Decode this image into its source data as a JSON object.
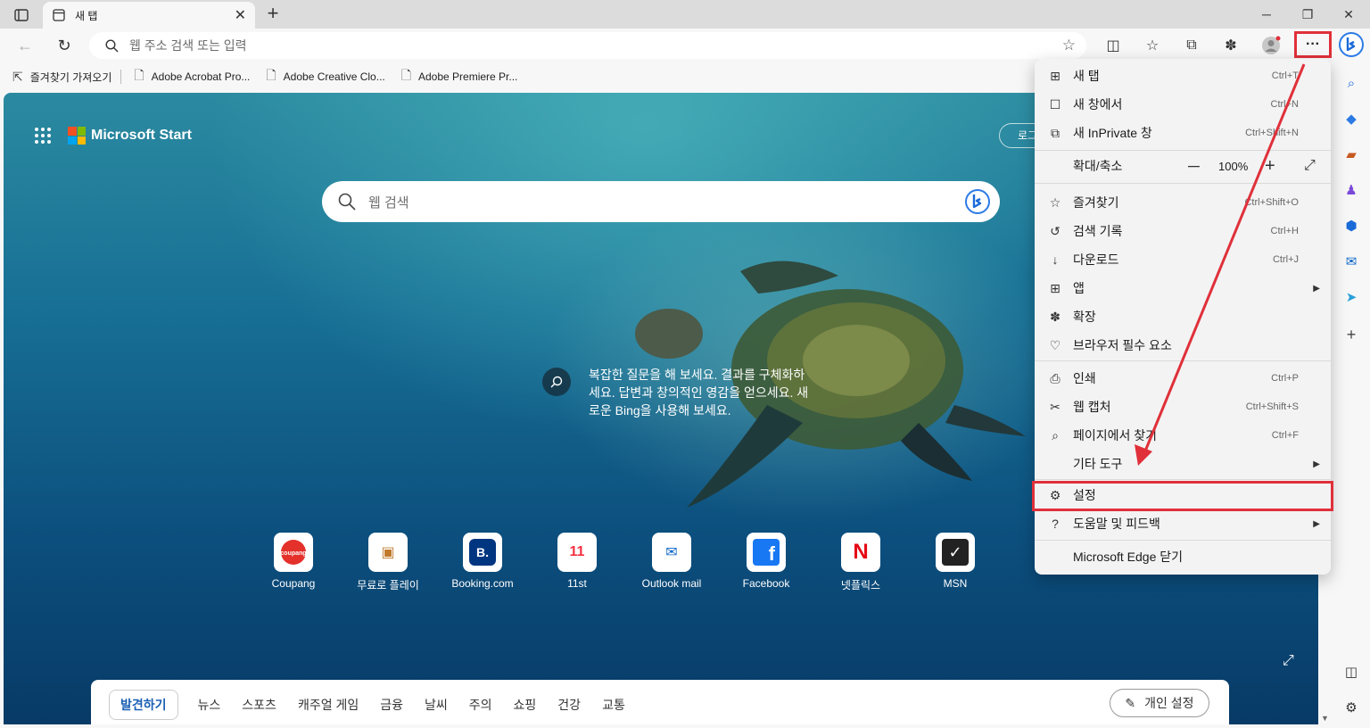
{
  "tab": {
    "title": "새 탭"
  },
  "address": {
    "placeholder": "웹 주소 검색 또는 입력"
  },
  "favorites": [
    {
      "label": "즐겨찾기 가져오기"
    },
    {
      "label": "Adobe Acrobat Pro..."
    },
    {
      "label": "Adobe Creative Clo..."
    },
    {
      "label": "Adobe Premiere Pr..."
    }
  ],
  "newtab": {
    "brand": "Microsoft Start",
    "login": "로그",
    "search_placeholder": "웹 검색",
    "bing_promo": "복잡한 질문을 해 보세요. 결과를 구체화하세요. 답변과 창의적인 영감을 얻으세요. 새로운 Bing을 사용해 보세요."
  },
  "quick_links": [
    {
      "label": "Coupang",
      "tile": "coupang",
      "color": "#e4312b"
    },
    {
      "label": "무료로 플레이",
      "tile": "▣",
      "color": "#c0792c"
    },
    {
      "label": "Booking.com",
      "tile": "B.",
      "color": "#003580"
    },
    {
      "label": "11st",
      "tile": "11",
      "color": "#f43142"
    },
    {
      "label": "Outlook mail",
      "tile": "✉",
      "color": "#0a64c8"
    },
    {
      "label": "Facebook",
      "tile": "f",
      "color": "#1877f2"
    },
    {
      "label": "넷플릭스",
      "tile": "N",
      "color": "#e50914"
    },
    {
      "label": "MSN",
      "tile": "✓",
      "color": "#222222"
    }
  ],
  "feed_tabs": [
    "발견하기",
    "뉴스",
    "스포츠",
    "캐주얼 게임",
    "금융",
    "날씨",
    "주의",
    "쇼핑",
    "건강",
    "교통"
  ],
  "personalize": "개인 설정",
  "menu": {
    "items": [
      {
        "label": "새 탭",
        "shortcut": "Ctrl+T",
        "icon": "⊞"
      },
      {
        "label": "새 창에서",
        "shortcut": "Ctrl+N",
        "icon": "☐"
      },
      {
        "label": "새 InPrivate 창",
        "shortcut": "Ctrl+Shift+N",
        "icon": "⧉"
      },
      {
        "label": "즐겨찾기",
        "shortcut": "Ctrl+Shift+O",
        "icon": "☆"
      },
      {
        "label": "검색 기록",
        "shortcut": "Ctrl+H",
        "icon": "↺"
      },
      {
        "label": "다운로드",
        "shortcut": "Ctrl+J",
        "icon": "↓"
      },
      {
        "label": "앱",
        "shortcut": "",
        "icon": "⊞"
      },
      {
        "label": "확장",
        "shortcut": "",
        "icon": "✽"
      },
      {
        "label": "브라우저 필수 요소",
        "shortcut": "",
        "icon": "♡"
      },
      {
        "label": "인쇄",
        "shortcut": "Ctrl+P",
        "icon": "⎙"
      },
      {
        "label": "웹 캡처",
        "shortcut": "Ctrl+Shift+S",
        "icon": "✂"
      },
      {
        "label": "페이지에서 찾기",
        "shortcut": "Ctrl+F",
        "icon": "⌕"
      },
      {
        "label": "기타 도구",
        "shortcut": "",
        "icon": ""
      },
      {
        "label": "설정",
        "shortcut": "",
        "icon": "⚙"
      },
      {
        "label": "도움말 및 피드백",
        "shortcut": "",
        "icon": "?"
      },
      {
        "label": "Microsoft Edge 닫기",
        "shortcut": "",
        "icon": ""
      }
    ],
    "zoom": {
      "label": "확대/축소",
      "value": "100%"
    }
  }
}
